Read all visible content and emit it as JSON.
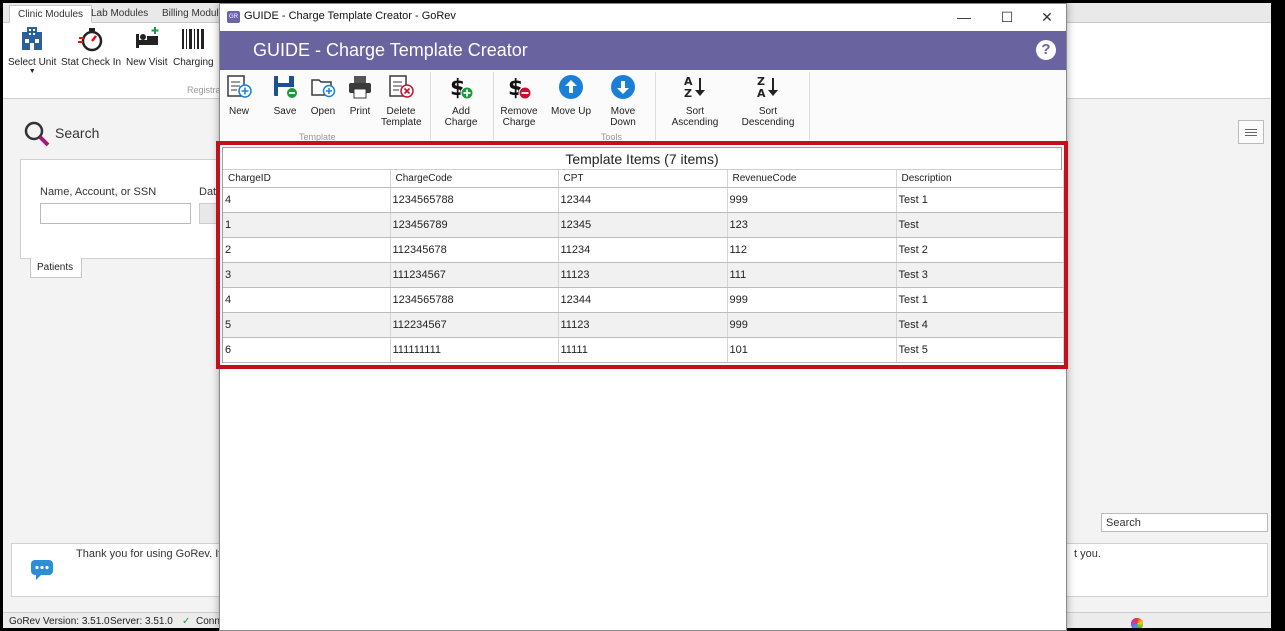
{
  "background_app": {
    "tabs": [
      "Clinic Modules",
      "Lab Modules",
      "Billing Modules"
    ],
    "ribbon": {
      "buttons": [
        "Select Unit",
        "Stat Check In",
        "New Visit",
        "Charging"
      ],
      "group_label": "Registra"
    },
    "search": {
      "title": "Search",
      "name_label": "Name, Account, or SSN",
      "dat_label": "Dat",
      "patients_tab": "Patients",
      "right_search_value": "Search"
    },
    "message": {
      "text": "Thank you for using GoRev.  It",
      "suffix": "t you."
    },
    "status": {
      "version": "GoRev Version: 3.51.0",
      "server": "Server: 3.51.0",
      "connection": "Conn"
    }
  },
  "dialog": {
    "window_title": "GUIDE - Charge Template Creator - GoRev",
    "header_title": "GUIDE - Charge Template Creator",
    "help_label": "?",
    "ribbon": {
      "template_group_label": "Template",
      "tools_group_label": "Tools",
      "buttons": {
        "new": "New",
        "save": "Save",
        "open": "Open",
        "print": "Print",
        "delete_line1": "Delete",
        "delete_line2": "Template",
        "add_charge": "Add Charge",
        "remove_line1": "Remove",
        "remove_line2": "Charge",
        "move_up": "Move Up",
        "move_down": "Move Down",
        "sort_ascending": "Sort Ascending",
        "sort_descending": "Sort Descending"
      }
    },
    "table": {
      "title": "Template Items (7 items)",
      "columns": [
        "ChargeID",
        "ChargeCode",
        "CPT",
        "RevenueCode",
        "Description"
      ],
      "rows": [
        [
          "4",
          "1234565788",
          "12344",
          "999",
          "Test 1"
        ],
        [
          "1",
          "123456789",
          "12345",
          "123",
          "Test"
        ],
        [
          "2",
          "112345678",
          "11234",
          "112",
          "Test 2"
        ],
        [
          "3",
          "111234567",
          "11123",
          "111",
          "Test 3"
        ],
        [
          "4",
          "1234565788",
          "12344",
          "999",
          "Test 1"
        ],
        [
          "5",
          "112234567",
          "11123",
          "999",
          "Test 4"
        ],
        [
          "6",
          "111111111",
          "11111",
          "101",
          "Test 5"
        ]
      ]
    }
  },
  "colors": {
    "header_band": "#69639f",
    "highlight_frame": "#c3101a",
    "save_blue": "#1b4f96",
    "move_blue": "#1a7fd6"
  }
}
